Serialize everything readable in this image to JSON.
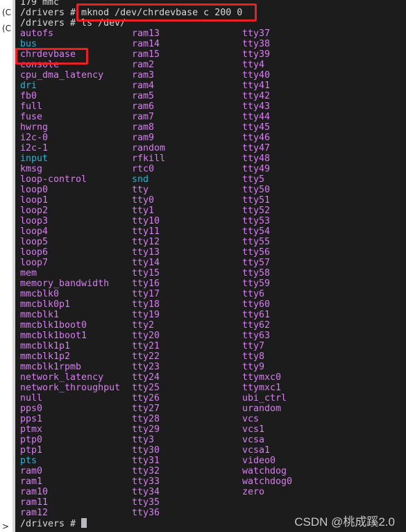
{
  "left_margin": {
    "items": [
      "(C",
      "(C"
    ],
    "expand_glyph": ">"
  },
  "terminal": {
    "lines": [
      "179 mmc",
      "/drivers # mknod /dev/chrdevbase c 200 0",
      "/drivers # ls /dev/"
    ],
    "prompt": "/drivers # ",
    "highlight_color": "#e8202a",
    "file_color": "#d77ef0",
    "dir_color": "#27b6d8",
    "directories": [
      "bus",
      "dri",
      "input",
      "snd",
      "pts"
    ],
    "columns": [
      [
        "autofs",
        "bus",
        "chrdevbase",
        "console",
        "cpu_dma_latency",
        "dri",
        "fb0",
        "full",
        "fuse",
        "hwrng",
        "i2c-0",
        "i2c-1",
        "input",
        "kmsg",
        "loop-control",
        "loop0",
        "loop1",
        "loop2",
        "loop3",
        "loop4",
        "loop5",
        "loop6",
        "loop7",
        "mem",
        "memory_bandwidth",
        "mmcblk0",
        "mmcblk0p1",
        "mmcblk1",
        "mmcblk1boot0",
        "mmcblk1boot1",
        "mmcblk1p1",
        "mmcblk1p2",
        "mmcblk1rpmb",
        "network_latency",
        "network_throughput",
        "null",
        "pps0",
        "pps1",
        "ptmx",
        "ptp0",
        "ptp1",
        "pts",
        "ram0",
        "ram1",
        "ram10",
        "ram11",
        "ram12"
      ],
      [
        "ram13",
        "ram14",
        "ram15",
        "ram2",
        "ram3",
        "ram4",
        "ram5",
        "ram6",
        "ram7",
        "ram8",
        "ram9",
        "random",
        "rfkill",
        "rtc0",
        "snd",
        "tty",
        "tty0",
        "tty1",
        "tty10",
        "tty11",
        "tty12",
        "tty13",
        "tty14",
        "tty15",
        "tty16",
        "tty17",
        "tty18",
        "tty19",
        "tty2",
        "tty20",
        "tty21",
        "tty22",
        "tty23",
        "tty24",
        "tty25",
        "tty26",
        "tty27",
        "tty28",
        "tty29",
        "tty3",
        "tty30",
        "tty31",
        "tty32",
        "tty33",
        "tty34",
        "tty35",
        "tty36"
      ],
      [
        "tty37",
        "tty38",
        "tty39",
        "tty4",
        "tty40",
        "tty41",
        "tty42",
        "tty43",
        "tty44",
        "tty45",
        "tty46",
        "tty47",
        "tty48",
        "tty49",
        "tty5",
        "tty50",
        "tty51",
        "tty52",
        "tty53",
        "tty54",
        "tty55",
        "tty56",
        "tty57",
        "tty58",
        "tty59",
        "tty6",
        "tty60",
        "tty61",
        "tty62",
        "tty63",
        "tty7",
        "tty8",
        "tty9",
        "ttymxc0",
        "ttymxc1",
        "ubi_ctrl",
        "urandom",
        "vcs",
        "vcs1",
        "vcsa",
        "vcsa1",
        "video0",
        "watchdog",
        "watchdog0",
        "zero"
      ]
    ]
  },
  "watermark": "CSDN @桃成蹊2.0"
}
